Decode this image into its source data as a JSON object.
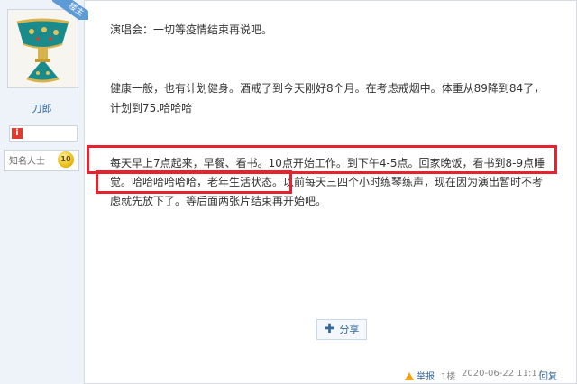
{
  "author": {
    "badge": "楼主",
    "username": "刀郎",
    "info_icon": "i",
    "rank_label": "知名人士",
    "rank_level": "10"
  },
  "post": {
    "paragraphs": [
      "演唱会：一切等疫情结束再说吧。",
      "健康一般，也有计划健身。酒戒了到今天刚好8个月。在考虑戒烟中。体重从89降到84了，",
      "计划到75.哈哈哈",
      "每天早上7点起来，早餐、看书。10点开始工作。到下午4-5点。回家晚饭，看书到8-9点睡",
      "觉。哈哈哈哈哈哈，老年生活状态。以前每天三四个小时练琴练声，现在因为演出暂时不考",
      "虑就先放下了。等后面两张片结束再开始吧。"
    ]
  },
  "actions": {
    "share_label": "分享",
    "report_label": "举报",
    "floor": "1楼",
    "timestamp": "2020-06-22 11:17",
    "reply_label": "回复"
  },
  "colors": {
    "highlight": "#e8212f",
    "link": "#336699",
    "sidebar_bg": "#eef3fa"
  }
}
